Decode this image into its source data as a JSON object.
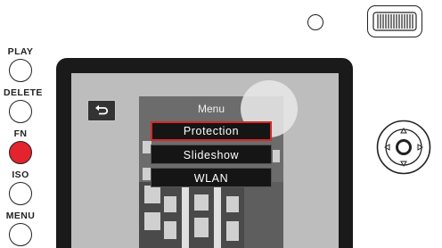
{
  "buttons": {
    "play": "PLAY",
    "delete": "DELETE",
    "fn": "FN",
    "iso": "ISO",
    "menu": "MENU"
  },
  "screen": {
    "menu_title": "Menu",
    "menu_items": [
      "Protection",
      "Slideshow",
      "WLAN"
    ],
    "selected_item": "Protection"
  },
  "icons": {
    "back": "return-arrow-icon",
    "dpad_up": "up-triangle-icon",
    "dpad_down": "down-triangle-icon",
    "dpad_left": "left-triangle-icon",
    "dpad_right": "right-triangle-icon"
  },
  "colors": {
    "accent": "#e3232d",
    "selection_border": "#d62828"
  }
}
